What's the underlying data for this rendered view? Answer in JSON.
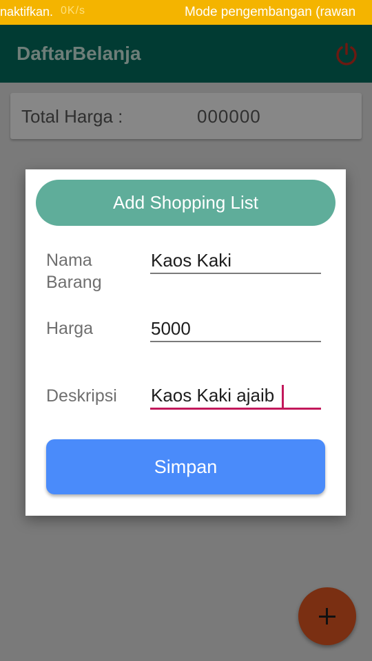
{
  "status_bar": {
    "left_text": "naktifkan.",
    "faded_text": "0K/s",
    "right_text": "Mode pengembangan (rawan"
  },
  "app_bar": {
    "title": "DaftarBelanja",
    "power_icon": "power-icon"
  },
  "total": {
    "label": "Total Harga :",
    "value": "000000"
  },
  "dialog": {
    "title": "Add Shopping List",
    "fields": [
      {
        "label": "Nama\nBarang",
        "value": "Kaos Kaki"
      },
      {
        "label": "Harga",
        "value": "5000"
      },
      {
        "label": "Deskripsi",
        "value": "Kaos Kaki ajaib"
      }
    ],
    "save_label": "Simpan"
  },
  "fab": {
    "icon": "plus-icon"
  },
  "colors": {
    "status_bar": "#f4b400",
    "app_bar": "#013b33",
    "header_pill": "#5fad9a",
    "save_button": "#4a8bfa",
    "focus_underline": "#c2185b",
    "fab": "#7a2f12"
  }
}
